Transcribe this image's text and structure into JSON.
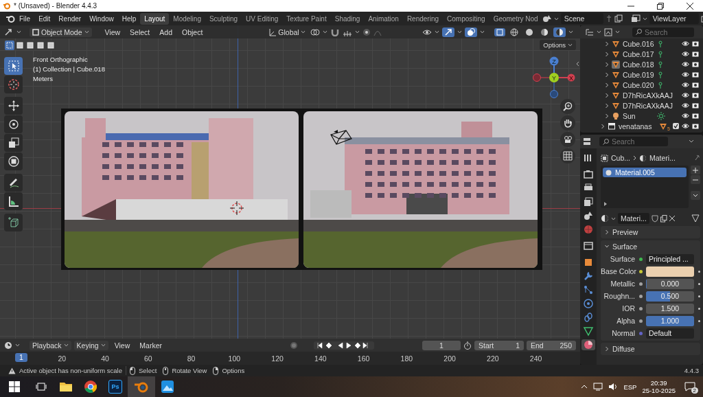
{
  "window": {
    "title": "* (Unsaved) - Blender 4.4.3"
  },
  "menus": [
    "File",
    "Edit",
    "Render",
    "Window",
    "Help"
  ],
  "workspaces": [
    {
      "label": "Layout",
      "selected": true
    },
    {
      "label": "Modeling",
      "selected": false
    },
    {
      "label": "Sculpting",
      "selected": false
    },
    {
      "label": "UV Editing",
      "selected": false
    },
    {
      "label": "Texture Paint",
      "selected": false
    },
    {
      "label": "Shading",
      "selected": false
    },
    {
      "label": "Animation",
      "selected": false
    },
    {
      "label": "Rendering",
      "selected": false
    },
    {
      "label": "Compositing",
      "selected": false
    },
    {
      "label": "Geometry Nod",
      "selected": false
    }
  ],
  "scene": "Scene",
  "view_layer": "ViewLayer",
  "viewport": {
    "mode": "Object Mode",
    "menus": [
      "View",
      "Select",
      "Add",
      "Object"
    ],
    "orientation": "Global",
    "options": "Options",
    "info": [
      "Front Orthographic",
      "(1) Collection | Cube.018",
      "Meters"
    ],
    "select_modes": [
      {
        "selected": true
      },
      {
        "selected": false
      },
      {
        "selected": false
      },
      {
        "selected": false
      },
      {
        "selected": false
      }
    ],
    "tools": [
      {
        "kind": "select",
        "selected": true
      },
      {
        "kind": "cursor",
        "selected": false
      },
      {
        "kind": "move",
        "selected": false
      },
      {
        "kind": "rotate",
        "selected": false
      },
      {
        "kind": "scale",
        "selected": false
      },
      {
        "kind": "transform",
        "selected": false
      },
      {
        "kind": "annotate",
        "selected": false
      },
      {
        "kind": "measure",
        "selected": false
      },
      {
        "kind": "add-cube",
        "selected": false
      }
    ],
    "shading": [
      {
        "kind": "wire",
        "selected": false
      },
      {
        "kind": "solid",
        "selected": false
      },
      {
        "kind": "material",
        "selected": false
      },
      {
        "kind": "rendered",
        "selected": true
      }
    ],
    "gizmo": {
      "z": "Z",
      "y": "Y",
      "x": "X"
    }
  },
  "outliner": {
    "search": "Search",
    "objects": [
      {
        "name": "Cube.016",
        "kind": "mesh",
        "active": false,
        "data_icon": true
      },
      {
        "name": "Cube.017",
        "kind": "mesh",
        "active": false,
        "data_icon": true
      },
      {
        "name": "Cube.018",
        "kind": "mesh",
        "active": true,
        "data_icon": true
      },
      {
        "name": "Cube.019",
        "kind": "mesh",
        "active": false,
        "data_icon": true
      },
      {
        "name": "Cube.020",
        "kind": "mesh",
        "active": false,
        "data_icon": true
      },
      {
        "name": "D7hRicAXkAAJ",
        "kind": "mesh",
        "active": false,
        "data_icon": false
      },
      {
        "name": "D7hRicAXkAAJ",
        "kind": "mesh",
        "active": false,
        "data_icon": false
      },
      {
        "name": "Sun",
        "kind": "light",
        "active": false,
        "data_icon": true
      }
    ],
    "collections": [
      {
        "name": "venatanas",
        "count": "5",
        "checked": true
      }
    ]
  },
  "properties": {
    "search": "Search",
    "tabs": [
      {
        "kind": "tool",
        "selected": false
      },
      {
        "kind": "render",
        "selected": false
      },
      {
        "kind": "output",
        "selected": false
      },
      {
        "kind": "view-layer",
        "selected": false
      },
      {
        "kind": "scene",
        "selected": false
      },
      {
        "kind": "world",
        "selected": false
      },
      {
        "kind": "collection",
        "selected": false
      },
      {
        "kind": "object",
        "selected": false
      },
      {
        "kind": "modifier",
        "selected": false
      },
      {
        "kind": "particles",
        "selected": false
      },
      {
        "kind": "physics",
        "selected": false
      },
      {
        "kind": "constraints",
        "selected": false
      },
      {
        "kind": "data",
        "selected": false
      },
      {
        "kind": "material",
        "selected": true
      }
    ],
    "breadcrumb": [
      "Cub...",
      "Materi..."
    ],
    "slots": [
      {
        "name": "Material.005",
        "selected": true
      }
    ],
    "material": "Materi...",
    "panels": [
      {
        "title": "Preview",
        "expanded": false
      },
      {
        "title": "Surface",
        "expanded": true,
        "fields": [
          {
            "label": "Surface",
            "kind": "shader",
            "value": "Principled ..."
          },
          {
            "label": "Base Color",
            "kind": "swatch",
            "color": "#ebd0af"
          },
          {
            "label": "Metallic",
            "kind": "slider",
            "value": "0.000",
            "level": 0
          },
          {
            "label": "Roughn...",
            "kind": "slider",
            "value": "0.500",
            "level": 0.5
          },
          {
            "label": "IOR",
            "kind": "number",
            "value": "1.500"
          },
          {
            "label": "Alpha",
            "kind": "slider",
            "value": "1.000",
            "level": 1
          },
          {
            "label": "Normal",
            "kind": "vector",
            "value": "Default"
          }
        ]
      },
      {
        "title": "Diffuse",
        "expanded": false
      }
    ]
  },
  "timeline": {
    "menus": [
      "Playback",
      "Keying",
      "View",
      "Marker"
    ],
    "frame": "1",
    "start_label": "Start",
    "start": "1",
    "end_label": "End",
    "end": "250",
    "current": "1",
    "ticks": [
      "20",
      "40",
      "60",
      "80",
      "100",
      "120",
      "140",
      "160",
      "180",
      "200",
      "220",
      "240"
    ]
  },
  "status": {
    "warning": "Active object has non-uniform scale",
    "hints": [
      {
        "kind": "left",
        "label": "Select"
      },
      {
        "kind": "middle",
        "label": "Rotate View"
      },
      {
        "kind": "right",
        "label": "Options"
      }
    ],
    "version": "4.4.3"
  },
  "taskbar": {
    "apps": [
      {
        "kind": "explorer",
        "selected": false
      },
      {
        "kind": "chrome",
        "selected": false
      },
      {
        "kind": "photoshop",
        "label": "Ps",
        "selected": false
      },
      {
        "kind": "blender",
        "selected": true
      },
      {
        "kind": "photos",
        "selected": false
      }
    ],
    "language": "ESP",
    "time": "20:39",
    "date": "25-10-2025",
    "notifications": "2"
  }
}
